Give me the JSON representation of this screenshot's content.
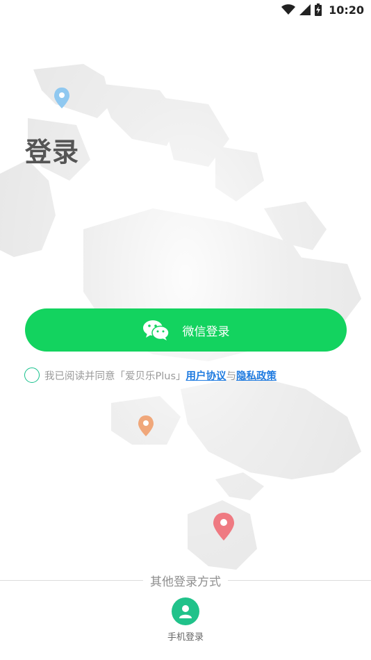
{
  "status_bar": {
    "time": "10:20",
    "icons": [
      "wifi-icon",
      "cellular-signal-icon",
      "battery-charging-icon"
    ]
  },
  "page": {
    "title": "登录"
  },
  "login": {
    "wechat_button_label": "微信登录",
    "wechat_icon": "wechat-icon"
  },
  "agreement": {
    "prefix": "我已阅读并同意「爱贝乐Plus」",
    "user_agreement": "用户协议",
    "conjunction": "与",
    "privacy_policy": "隐私政策",
    "checked": false
  },
  "other_login": {
    "divider_label": "其他登录方式",
    "methods": [
      {
        "label": "手机登录",
        "icon": "user-icon"
      }
    ]
  },
  "colors": {
    "primary_green": "#13d35f",
    "link_blue": "#1f7be0",
    "icon_teal": "#20c28a",
    "pin_blue": "#8fc8f0",
    "pin_orange": "#f0a77a",
    "pin_red": "#ef7a82"
  }
}
